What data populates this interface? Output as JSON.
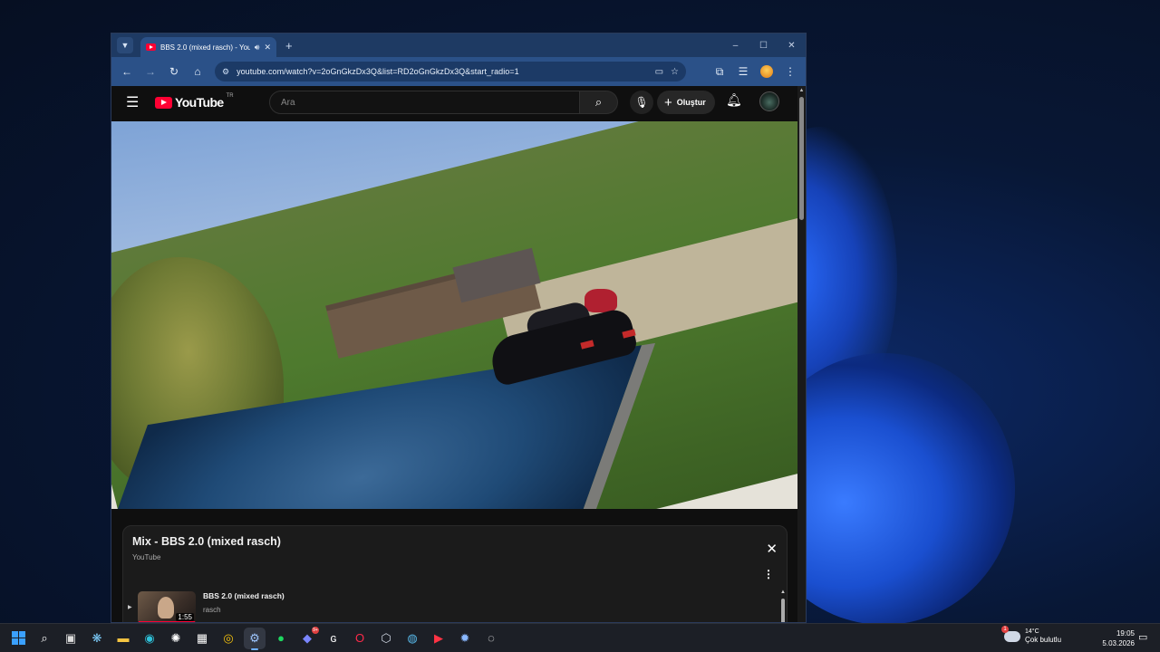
{
  "browser": {
    "tab_title": "BBS 2.0 (mixed rasch) - You",
    "tab_menu_icon": "chevron-down-icon",
    "new_tab_label": "+",
    "window_controls": [
      "–",
      "☐",
      "✕"
    ],
    "url": "youtube.com/watch?v=2oGnGkzDx3Q&list=RD2oGnGkzDx3Q&start_radio=1"
  },
  "youtube": {
    "logo_text": "YouTube",
    "country_code": "TR",
    "search_placeholder": "Ara",
    "create_label": "Oluştur"
  },
  "mix": {
    "title": "Mix - BBS 2.0 (mixed rasch)",
    "subtitle": "YouTube",
    "items": [
      {
        "title": "BBS 2.0 (mixed rasch)",
        "channel": "rasch",
        "duration": "1:55"
      }
    ]
  },
  "taskbar": {
    "apps": [
      "start",
      "search",
      "task-view",
      "copilot",
      "file-explorer",
      "edge",
      "chatgpt",
      "store",
      "chrome",
      "steam",
      "spotify",
      "discord",
      "app-g",
      "opera",
      "app-hex",
      "earth",
      "youtube-music",
      "app-gear",
      "app-chatbubble"
    ],
    "discord_badge": "9+",
    "weather_temp": "14°C",
    "weather_desc": "Çok bulutlu",
    "weather_badge": "1",
    "time": "19:05",
    "date": "5.03.2026"
  },
  "colors": {
    "youtube_red": "#ff0033",
    "browser_chrome": "#2b5188",
    "page_bg": "#0f0f0f"
  }
}
